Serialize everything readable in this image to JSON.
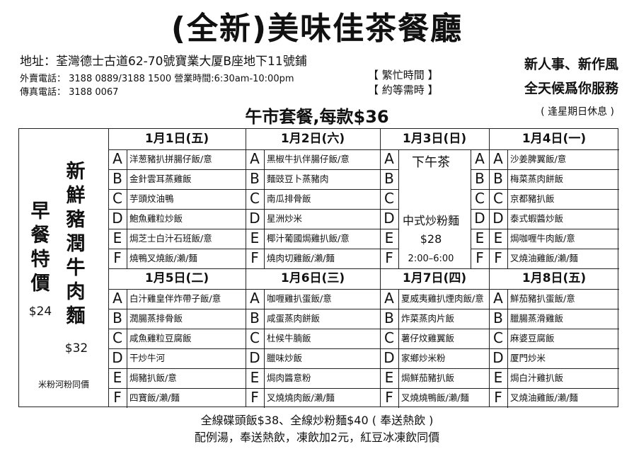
{
  "title": "(全新)美味佳茶餐廳",
  "address": "地址：荃灣德士古道62-70號寶業大厦B座地下11號鋪",
  "phone_hours": "外賣電話： 3188 0889/3188 1500  營業時間:6:30am-10:00pm",
  "fax": "傳真電話： 3188 0067",
  "busy": [
    "【 繁忙時間 】",
    "【 約等需時 】"
  ],
  "slogan": [
    "新人事、新作風",
    "全天候爲你服務"
  ],
  "closed": "( 逢星期日休息 )",
  "lunch_title": "午市套餐,每款$36",
  "breakfast": {
    "title": "早餐特價",
    "price": "$24",
    "note": "米粉河粉同價"
  },
  "noodle": {
    "title": "新鮮豬潤牛肉麵",
    "price": "$32"
  },
  "tea": {
    "title": "下午茶",
    "name": "中式炒粉麵",
    "price": "$28",
    "time": "2:00–6:00"
  },
  "days": [
    {
      "date": "1月1日(五)",
      "items": [
        [
          "A",
          "洋葱豬扒拼腸仔飯/意"
        ],
        [
          "B",
          "金針雲耳蒸雞飯"
        ],
        [
          "C",
          "芋頭炆油鴨"
        ],
        [
          "D",
          "鮑魚雞粒炒飯"
        ],
        [
          "E",
          "焗芝士白汁石班飯/意"
        ],
        [
          "F",
          "燒鴨叉燒飯/瀨/麵"
        ]
      ]
    },
    {
      "date": "1月2日(六)",
      "items": [
        [
          "A",
          "黑椒牛扒伴腸仔飯/意"
        ],
        [
          "B",
          "麵豉豆卜蒸豬肉"
        ],
        [
          "C",
          "南瓜排骨飯"
        ],
        [
          "D",
          "星洲炒米"
        ],
        [
          "E",
          "椰汁葡國焗雞扒飯/意"
        ],
        [
          "F",
          "燒肉切雞飯/瀨/麵"
        ]
      ]
    },
    {
      "date": "1月3日(日)",
      "items": [
        [
          "A",
          ""
        ],
        [
          "B",
          ""
        ],
        [
          "C",
          ""
        ],
        [
          "D",
          ""
        ],
        [
          "E",
          ""
        ],
        [
          "F",
          ""
        ]
      ]
    },
    {
      "date": "1月4日(一)",
      "items": [
        [
          "A",
          "沙姜脾翼飯/意"
        ],
        [
          "B",
          "梅菜蒸肉餅飯"
        ],
        [
          "C",
          "京都豬扒飯"
        ],
        [
          "D",
          "泰式蝦醬炒飯"
        ],
        [
          "E",
          "焗咖喱牛肉飯/意"
        ],
        [
          "F",
          "叉燒油雞飯/瀨/麵"
        ]
      ]
    },
    {
      "date": "1月5日(二)",
      "items": [
        [
          "A",
          "白汁雞皇伴炸帶子飯/意"
        ],
        [
          "B",
          "潤腸蒸排骨飯"
        ],
        [
          "C",
          "咸魚雞粒豆腐飯"
        ],
        [
          "D",
          "干炒牛河"
        ],
        [
          "E",
          "焗豬扒飯/意"
        ],
        [
          "F",
          "四寶飯/瀨/麵"
        ]
      ]
    },
    {
      "date": "1月6日(三)",
      "items": [
        [
          "A",
          "咖喱雞扒蛋飯/意"
        ],
        [
          "B",
          "咸蛋蒸肉餅飯"
        ],
        [
          "C",
          "杜候牛腩飯"
        ],
        [
          "D",
          "臘味炒飯"
        ],
        [
          "E",
          "焗肉醬意粉"
        ],
        [
          "F",
          "叉燒燒肉飯/瀨/麵"
        ]
      ]
    },
    {
      "date": "1月7日(四)",
      "items": [
        [
          "A",
          "夏威夷雞扒煙肉飯/意"
        ],
        [
          "B",
          "炸菜蒸肉片飯"
        ],
        [
          "C",
          "薯仔炆雞翼飯"
        ],
        [
          "D",
          "家鄉炒米粉"
        ],
        [
          "E",
          "焗鮮茄豬扒飯"
        ],
        [
          "F",
          "叉燒燒鴨飯/瀨/麵"
        ]
      ]
    },
    {
      "date": "1月8日(五)",
      "items": [
        [
          "A",
          "鮮茄豬扒蛋飯/意"
        ],
        [
          "B",
          "臘腸蒸滑雞飯"
        ],
        [
          "C",
          "麻婆豆腐飯"
        ],
        [
          "D",
          "厦門炒米"
        ],
        [
          "E",
          "焗白汁雞扒飯"
        ],
        [
          "F",
          "叉燒油雞飯/瀨/麵"
        ]
      ]
    }
  ],
  "footer": [
    "全線碟頭飯$38、全線炒粉麵$40 ( 奉送熱飲 )",
    "配例湯，奉送熱飲，凍飲加2元，紅豆冰凍飲同價"
  ]
}
